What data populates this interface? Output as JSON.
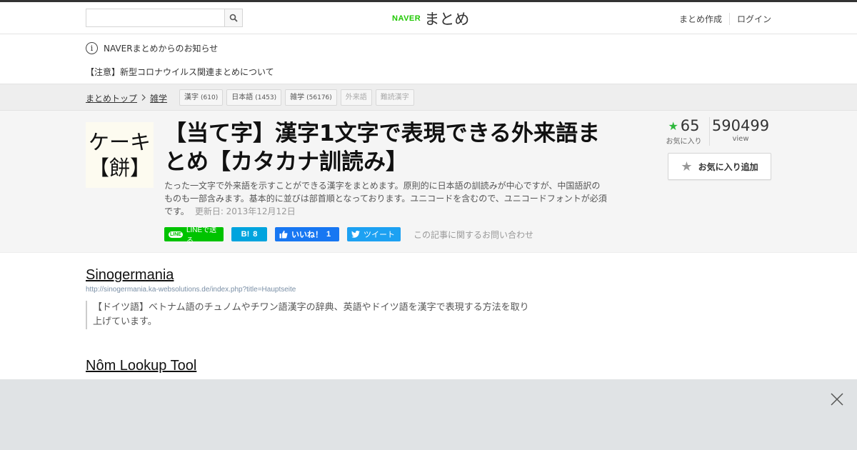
{
  "header": {
    "search_placeholder": "",
    "logo_naver": "NAVER",
    "logo_matome": "まとめ",
    "create_link": "まとめ作成",
    "login_link": "ログイン"
  },
  "notice": {
    "info_label": "NAVERまとめからのお知らせ",
    "link_text": "【注意】新型コロナウイルス関連まとめについて"
  },
  "breadcrumb": {
    "items": [
      "まとめトップ",
      "雑学"
    ],
    "tags": [
      {
        "label": "漢字",
        "count": "(610)"
      },
      {
        "label": "日本語",
        "count": "(1453)"
      },
      {
        "label": "雑学",
        "count": "(56176)"
      },
      {
        "label": "外来語",
        "count": ""
      },
      {
        "label": "難読漢字",
        "count": ""
      }
    ]
  },
  "article": {
    "thumb_line1": "ケーキ",
    "thumb_line2": "【餅】",
    "title": "【当て字】漢字1文字で表現できる外来語まとめ【カタカナ訓読み】",
    "description": "たった一文字で外来語を示すことができる漢字をまとめます。原則的に日本語の訓読みが中心ですが、中国語訳のものも一部含みます。基本的に並びは部首順となっております。ユニコードを含むので、ユニコードフォントが必須です。",
    "updated": "更新日: 2013年12月12日",
    "favorites_count": "65",
    "favorites_label": "お気に入り",
    "views_count": "590499",
    "views_label": "view",
    "fav_button": "お気に入り追加"
  },
  "share": {
    "line_badge": "LINE",
    "line_label": "LINEで送る",
    "hatena_logo": "B!",
    "hatena_count": "8",
    "facebook_label": "いいね！",
    "facebook_count": "1",
    "twitter_label": "ツイート",
    "contact": "この記事に関するお問い合わせ"
  },
  "links": [
    {
      "title": "Sinogermania",
      "url": "http://sinogermania.ka-websolutions.de/index.php?title=Hauptseite",
      "quote": "【ドイツ語】ベトナム語のチュノムやチワン語漢字の辞典、英語やドイツ語を漢字で表現する方法を取り上げています。"
    },
    {
      "title": "Nôm Lookup Tool"
    }
  ],
  "colors": {
    "naver_green": "#1ec800",
    "star_green": "#2eb83c",
    "line_green": "#00c300",
    "hatena_blue": "#00a4de",
    "facebook_blue": "#1877f2",
    "twitter_blue": "#1da1f2"
  },
  "icons": [
    "search-icon",
    "info-icon",
    "chevron-right-icon",
    "star-icon",
    "close-icon",
    "thumbs-up-icon",
    "twitter-bird-icon"
  ]
}
